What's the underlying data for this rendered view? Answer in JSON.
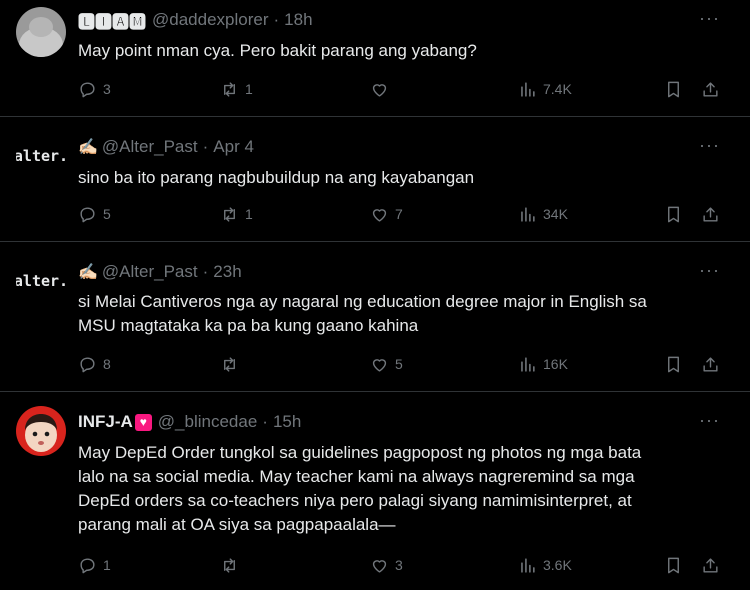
{
  "posts": [
    {
      "name": "🅻🅸🅰🅼",
      "handle": "@daddexplorer",
      "time": "18h",
      "text": "May point nman cya. Pero bakit parang ang yabang?",
      "replies": "3",
      "reposts": "1",
      "likes": "",
      "views": "7.4K"
    },
    {
      "name": "✍🏻",
      "handle": "@Alter_Past",
      "time": "Apr 4",
      "avatar_text": "alter.",
      "text": "sino ba ito parang nagbubuildup na ang kayabangan",
      "replies": "5",
      "reposts": "1",
      "likes": "7",
      "views": "34K"
    },
    {
      "name": "✍🏻",
      "handle": "@Alter_Past",
      "time": "23h",
      "avatar_text": "alter.",
      "text_lines": [
        "si Melai Cantiveros nga ay nagaral ng education degree major in English sa",
        "MSU magtataka ka pa ba kung gaano kahina"
      ],
      "replies": "8",
      "reposts": "",
      "likes": "5",
      "views": "16K"
    },
    {
      "name": "INFJ-A",
      "name_badge": "♥",
      "handle": "@_blincedae",
      "time": "15h",
      "text_lines": [
        "May DepEd Order tungkol sa guidelines pagpopost ng photos ng mga bata",
        "lalo na sa social media. May teacher kami na always nagreremind sa mga",
        "DepEd orders sa co-teachers niya pero palagi siyang namimisinterpret, at",
        "parang mali at OA siya sa pagpapaalala—"
      ],
      "replies": "1",
      "reposts": "",
      "likes": "3",
      "views": "3.6K"
    }
  ],
  "ui": {
    "more_label": "···",
    "dot": "·"
  },
  "colors": {
    "background": "#000000",
    "text": "#e7e9ea",
    "muted": "#71767b",
    "divider": "#2f3336",
    "badge": "#f91880"
  },
  "icons": [
    "reply-icon",
    "repost-icon",
    "like-icon",
    "views-icon",
    "bookmark-icon",
    "share-icon",
    "more-icon"
  ]
}
